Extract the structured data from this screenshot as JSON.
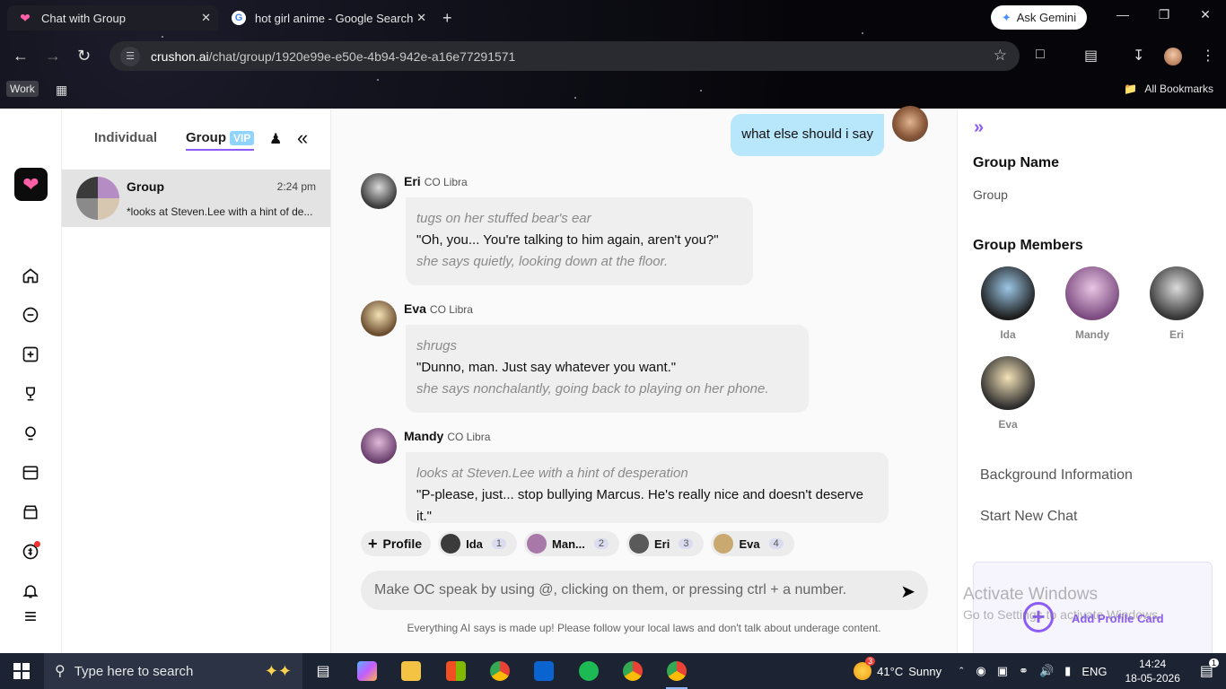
{
  "browser": {
    "tabs": [
      {
        "title": "Chat with Group",
        "active": true
      },
      {
        "title": "hot girl anime - Google Search",
        "active": false
      }
    ],
    "gemini_label": "Ask Gemini",
    "url_host": "crushon.ai",
    "url_path": "/chat/group/1920e99e-e50e-4b94-942e-a16e77291571",
    "work_label": "Work",
    "bookmarks_label": "All Bookmarks"
  },
  "list": {
    "tab_individual": "Individual",
    "tab_group": "Group",
    "vip_badge": "VIP",
    "chat": {
      "name": "Group",
      "time": "2:24 pm",
      "preview": "*looks at Steven.Lee with a hint of de..."
    }
  },
  "chat": {
    "my_message": "what else should i say",
    "messages": [
      {
        "name": "Eri",
        "tag": "CO Libra",
        "action1": "tugs on her stuffed bear's ear",
        "speech": "\"Oh, you... You're talking to him again, aren't you?\"",
        "action2": "she says quietly, looking down at the floor."
      },
      {
        "name": "Eva",
        "tag": "CO Libra",
        "action1": "shrugs",
        "speech": "\"Dunno, man. Just say whatever you want.\"",
        "action2": "she says nonchalantly, going back to playing on her phone."
      },
      {
        "name": "Mandy",
        "tag": "CO Libra",
        "action1": "looks at Steven.Lee with a hint of desperation",
        "speech": "\"P-please, just... stop bullying Marcus. He's really nice and doesn't deserve it.\"",
        "action2": ""
      }
    ],
    "profile_button": "Profile",
    "mention_chips": [
      {
        "name": "Ida",
        "num": "1"
      },
      {
        "name": "Man...",
        "num": "2"
      },
      {
        "name": "Eri",
        "num": "3"
      },
      {
        "name": "Eva",
        "num": "4"
      }
    ],
    "composer_placeholder": "Make OC speak by using @, clicking on them, or pressing ctrl + a number.",
    "disclaimer": "Everything AI says is made up! Please follow your local laws and don't talk about underage content."
  },
  "panel": {
    "group_name_title": "Group Name",
    "group_name_value": "Group",
    "members_title": "Group Members",
    "members": [
      "Ida",
      "Mandy",
      "Eri",
      "Eva"
    ],
    "background_info": "Background Information",
    "start_new_chat": "Start New Chat",
    "add_profile_card": "Add Profile Card",
    "watermark_title": "Activate Windows",
    "watermark_sub": "Go to Settings to activate Windows."
  },
  "taskbar": {
    "search_placeholder": "Type here to search",
    "weather_badge": "3",
    "temperature": "41°C",
    "condition": "Sunny",
    "language": "ENG",
    "time": "14:24",
    "date": "18-05-2026",
    "notifications": "1"
  },
  "colors": {
    "accent": "#8b5cf6",
    "my_bubble": "#b8e6fb",
    "vip": "#8fd3ff"
  }
}
